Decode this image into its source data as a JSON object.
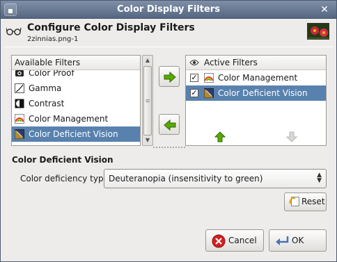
{
  "window": {
    "title": "Color Display Filters"
  },
  "titlebar": {
    "menu_glyph": "▪",
    "close_glyph": "✕"
  },
  "header": {
    "title": "Configure Color Display Filters",
    "subtitle": "2zinnias.png-1"
  },
  "available": {
    "header": "Available Filters",
    "items": [
      {
        "label": "Color Proof",
        "icon": "color-proof-icon"
      },
      {
        "label": "Gamma",
        "icon": "gamma-icon"
      },
      {
        "label": "Contrast",
        "icon": "contrast-icon"
      },
      {
        "label": "Color Management",
        "icon": "color-management-icon"
      },
      {
        "label": "Color Deficient Vision",
        "icon": "color-deficient-vision-icon",
        "selected": true
      }
    ]
  },
  "active": {
    "header": "Active Filters",
    "header_icon": "eye-icon",
    "items": [
      {
        "label": "Color Management",
        "checked": true,
        "icon": "color-management-icon"
      },
      {
        "label": "Color Deficient Vision",
        "checked": true,
        "icon": "color-deficient-vision-icon",
        "selected": true
      }
    ]
  },
  "config": {
    "section_title": "Color Deficient Vision",
    "deficiency_label": "Color deficiency type:",
    "deficiency_value": "Deuteranopia (insensitivity to green)"
  },
  "buttons": {
    "reset": "Reset",
    "cancel": "Cancel",
    "ok": "OK"
  },
  "colors": {
    "selection": "#5881ae",
    "arrow_green": "#4e9a06",
    "cancel_red": "#cc2222"
  }
}
